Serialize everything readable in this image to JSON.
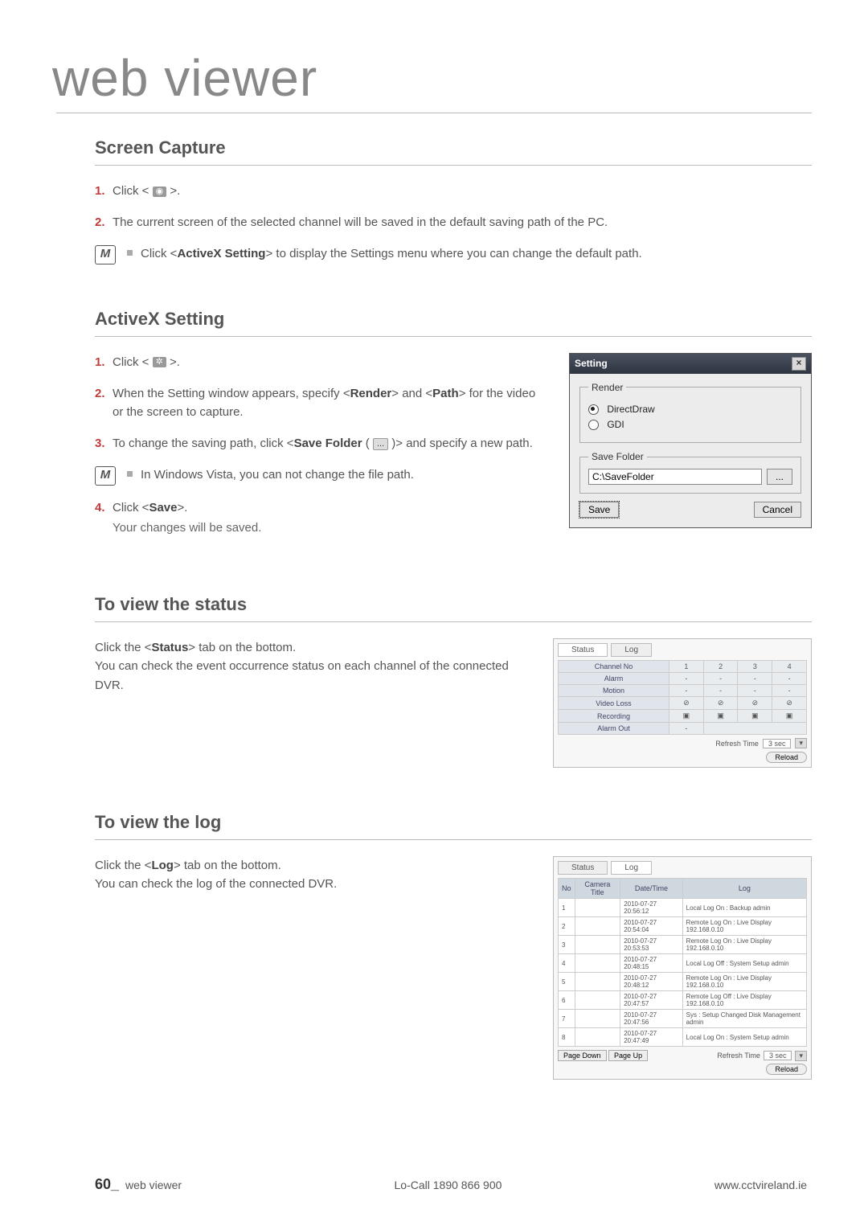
{
  "page_title": "web viewer",
  "sections": {
    "screen_capture": {
      "title": "Screen Capture",
      "step1_prefix": "Click < ",
      "step1_suffix": " >.",
      "step2": "The current screen of the selected channel will be saved in the default saving path of the PC.",
      "note_prefix": "Click <",
      "note_bold": "ActiveX Setting",
      "note_suffix": "> to display the Settings menu where you can change the default path."
    },
    "activex_setting": {
      "title": "ActiveX Setting",
      "step1_prefix": "Click < ",
      "step1_suffix": " >.",
      "step2_a": "When the Setting window appears, specify <",
      "step2_b": "Render",
      "step2_c": "> and <",
      "step2_d": "Path",
      "step2_e": "> for the video or the screen to capture.",
      "step3_a": "To change the saving path, click <",
      "step3_b": "Save Folder",
      "step3_c": " ( ",
      "step3_d": " )> and specify a new path.",
      "note": "In Windows Vista, you can not change the file path.",
      "step4_a": "Click <",
      "step4_b": "Save",
      "step4_c": ">.",
      "step4_sub": "Your changes will be saved.",
      "dialog": {
        "title": "Setting",
        "render_legend": "Render",
        "opt1": "DirectDraw",
        "opt2": "GDI",
        "folder_legend": "Save Folder",
        "path": "C:\\SaveFolder",
        "browse": "...",
        "save": "Save",
        "cancel": "Cancel"
      }
    },
    "view_status": {
      "title": "To view the status",
      "p1_a": "Click the <",
      "p1_b": "Status",
      "p1_c": "> tab on the bottom.",
      "p2": "You can check the event occurrence status on each channel of the connected DVR.",
      "panel": {
        "tab_status": "Status",
        "tab_log": "Log",
        "rows": [
          "Channel No",
          "Alarm",
          "Motion",
          "Video Loss",
          "Recording",
          "Alarm Out"
        ],
        "cols": [
          "1",
          "2",
          "3",
          "4"
        ],
        "refresh_label": "Refresh Time",
        "refresh_val": "3 sec",
        "reload": "Reload"
      }
    },
    "view_log": {
      "title": "To view the log",
      "p1_a": "Click the <",
      "p1_b": "Log",
      "p1_c": "> tab on the bottom.",
      "p2": "You can check the log of the connected DVR.",
      "panel": {
        "tab_status": "Status",
        "tab_log": "Log",
        "headers": [
          "No",
          "Camera Title",
          "Date/Time",
          "Log"
        ],
        "rows": [
          {
            "no": "1",
            "title": "",
            "dt": "2010-07-27  20:56:12",
            "log": "Local Log On : Backup admin"
          },
          {
            "no": "2",
            "title": "",
            "dt": "2010-07-27  20:54:04",
            "log": "Remote Log On : Live Display 192.168.0.10"
          },
          {
            "no": "3",
            "title": "",
            "dt": "2010-07-27  20:53:53",
            "log": "Remote Log On : Live Display 192.168.0.10"
          },
          {
            "no": "4",
            "title": "",
            "dt": "2010-07-27  20:48:15",
            "log": "Local Log Off : System Setup admin"
          },
          {
            "no": "5",
            "title": "",
            "dt": "2010-07-27  20:48:12",
            "log": "Remote Log On : Live Display 192.168.0.10"
          },
          {
            "no": "6",
            "title": "",
            "dt": "2010-07-27  20:47:57",
            "log": "Remote Log Off : Live Display 192.168.0.10"
          },
          {
            "no": "7",
            "title": "",
            "dt": "2010-07-27  20:47:56",
            "log": "Sys : Setup Changed Disk Management admin"
          },
          {
            "no": "8",
            "title": "",
            "dt": "2010-07-27  20:47:49",
            "log": "Local Log On : System Setup admin"
          }
        ],
        "page_down": "Page Down",
        "page_up": "Page Up",
        "refresh_label": "Refresh Time",
        "refresh_val": "3 sec",
        "reload": "Reload"
      }
    }
  },
  "footer": {
    "page_num": "60_",
    "section_name": "web viewer",
    "center": "Lo-Call  1890 866 900",
    "right": "www.cctvireland.ie"
  }
}
